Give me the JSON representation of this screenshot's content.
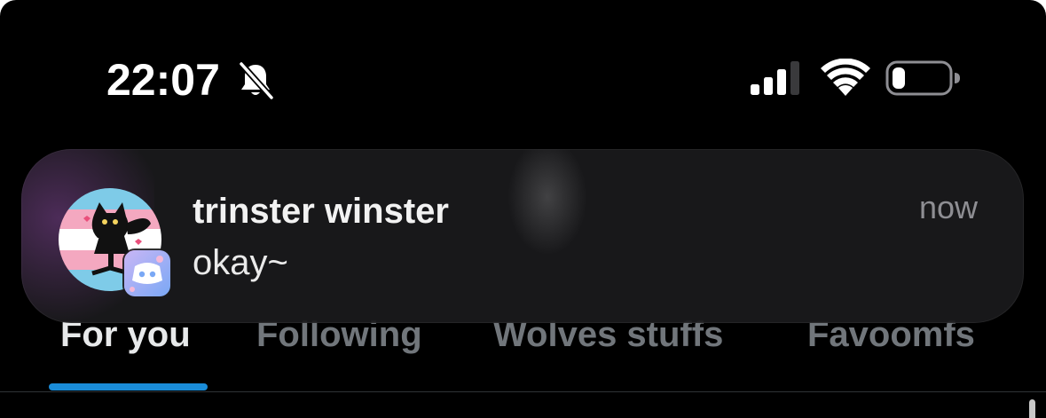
{
  "status_bar": {
    "time": "22:07",
    "icons": [
      "bell-slash-icon",
      "cellular-signal-icon",
      "wifi-icon",
      "battery-low-icon"
    ]
  },
  "tabs": [
    {
      "label": "For you",
      "active": true
    },
    {
      "label": "Following",
      "active": false
    },
    {
      "label": "Wolves stuffs",
      "active": false
    },
    {
      "label": "Favoomfs",
      "active": false
    }
  ],
  "notification": {
    "sender": "trinster winster",
    "message": "okay~",
    "time": "now",
    "app_icon": "discord-icon"
  },
  "colors": {
    "background": "#000000",
    "tab_indicator": "#1d9bf0",
    "tab_active": "#e7e9ea",
    "tab_inactive": "#71767b",
    "notification_bg": "#1a1a1c"
  }
}
